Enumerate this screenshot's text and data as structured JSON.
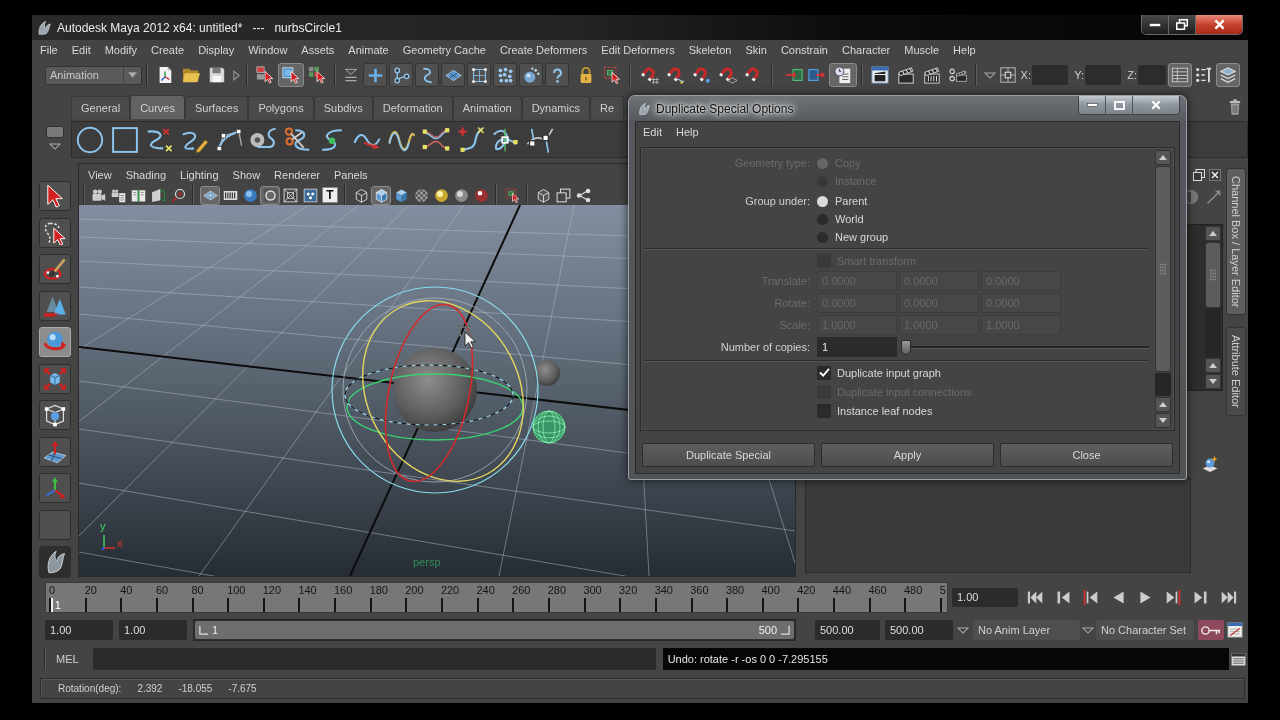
{
  "window": {
    "title": "Autodesk Maya 2012 x64: untitled*   ---   nurbsCircle1"
  },
  "menu_bar": [
    "File",
    "Edit",
    "Modify",
    "Create",
    "Display",
    "Window",
    "Assets",
    "Animate",
    "Geometry Cache",
    "Create Deformers",
    "Edit Deformers",
    "Skeleton",
    "Skin",
    "Constrain",
    "Character",
    "Muscle",
    "Help"
  ],
  "status_line": {
    "menu_set": "Animation",
    "selection_modes": [
      {
        "selected": false
      },
      {
        "selected": true
      },
      {
        "selected": false
      }
    ],
    "history": {
      "on": true
    },
    "coordinates": [
      {
        "label": "X:"
      },
      {
        "label": "Y:"
      },
      {
        "label": "Z:"
      }
    ],
    "panel_toggles": [
      {
        "on": true
      },
      {
        "on": false
      },
      {
        "on": true
      }
    ]
  },
  "shelf": {
    "tabs": [
      {
        "label": "General",
        "selected": false
      },
      {
        "label": "Curves",
        "selected": true
      },
      {
        "label": "Surfaces",
        "selected": false
      },
      {
        "label": "Polygons",
        "selected": false
      },
      {
        "label": "Subdivs",
        "selected": false
      },
      {
        "label": "Deformation",
        "selected": false
      },
      {
        "label": "Animation",
        "selected": false
      },
      {
        "label": "Dynamics",
        "selected": false
      },
      {
        "label": "Re",
        "selected": false
      }
    ]
  },
  "toolbox": {
    "tools": [
      {
        "selected": false
      },
      {
        "selected": false
      },
      {
        "selected": false
      },
      {
        "selected": false
      },
      {
        "selected": true
      },
      {
        "selected": false
      },
      {
        "selected": false
      },
      {
        "selected": false
      },
      {
        "selected": false
      }
    ]
  },
  "viewport": {
    "menu": [
      "View",
      "Shading",
      "Lighting",
      "Show",
      "Renderer",
      "Panels"
    ],
    "toolbar": [
      {
        "on": false
      },
      {
        "on": false
      },
      {
        "on": false
      },
      {
        "on": false
      },
      {
        "on": false
      },
      {
        "on": true
      },
      {
        "on": false
      },
      {
        "on": false
      },
      {
        "on": true
      },
      {
        "on": false
      },
      {
        "on": false
      },
      {
        "on": false,
        "label": "T"
      },
      {
        "on": false
      },
      {
        "on": true
      },
      {
        "on": false
      },
      {
        "on": false
      },
      {
        "on": false
      },
      {
        "on": false
      },
      {
        "on": false
      },
      {
        "on": false
      },
      {
        "on": false
      },
      {
        "on": false
      },
      {
        "on": false
      }
    ],
    "axis_labels": [
      "y",
      "x"
    ],
    "camera": "persp"
  },
  "side_panel": {
    "tabs": [
      {
        "label": "Channel Box / Layer Editor",
        "selected": true
      },
      {
        "label": "Attribute Editor",
        "selected": false
      }
    ]
  },
  "time_slider": {
    "ticks": [
      "0",
      "20",
      "40",
      "60",
      "80",
      "100",
      "120",
      "140",
      "160",
      "180",
      "200",
      "220",
      "240",
      "260",
      "280",
      "300",
      "320",
      "340",
      "360",
      "380",
      "400",
      "420",
      "440",
      "460",
      "480",
      "5"
    ],
    "current_frame": "1",
    "level": 0.002,
    "current_time": "1.00"
  },
  "range_slider": {
    "start_time": "1.00",
    "playback_start": "1.00",
    "range_start": "1",
    "range_end": "500",
    "level": 1,
    "playback_end": "500.00",
    "end_time": "500.00",
    "anim_layer": "No Anim Layer",
    "character_set": "No Character Set"
  },
  "command_line": {
    "language": "MEL",
    "result": "Undo: rotate -r -os 0 0 -7.295155"
  },
  "help_line": {
    "label": "Rotation(deg):",
    "values": [
      "2.392",
      "-18.055",
      "-7.675"
    ]
  },
  "dialog": {
    "title": "Duplicate Special Options",
    "menu": [
      "Edit",
      "Help"
    ],
    "sections": [
      {
        "rows": [
          {
            "kind": "radio",
            "label": "Geometry type:",
            "disabled": true,
            "options": [
              {
                "label": "Copy",
                "selected": true
              },
              {
                "label": "Instance",
                "selected": false
              }
            ]
          },
          {
            "kind": "radio",
            "label": "Group under:",
            "disabled": false,
            "options": [
              {
                "label": "Parent",
                "selected": true
              },
              {
                "label": "World",
                "selected": false
              },
              {
                "label": "New group",
                "selected": false
              }
            ]
          }
        ]
      },
      {
        "rows": [
          {
            "kind": "checkbox",
            "label": "Smart transform",
            "disabled": true,
            "checked": false
          },
          {
            "kind": "vector",
            "label": "Translate:",
            "disabled": true,
            "values": [
              "0.0000",
              "0.0000",
              "0.0000"
            ]
          },
          {
            "kind": "vector",
            "label": "Rotate:",
            "disabled": true,
            "values": [
              "0.0000",
              "0.0000",
              "0.0000"
            ]
          },
          {
            "kind": "vector",
            "label": "Scale:",
            "disabled": true,
            "values": [
              "1.0000",
              "1.0000",
              "1.0000"
            ]
          },
          {
            "kind": "slider",
            "label": "Number of copies:",
            "disabled": false,
            "value": "1",
            "level": 0
          }
        ]
      },
      {
        "rows": [
          {
            "kind": "checkbox",
            "label": "Duplicate input graph",
            "disabled": false,
            "checked": true
          },
          {
            "kind": "checkbox",
            "label": "Duplicate input connections",
            "disabled": true,
            "checked": false
          },
          {
            "kind": "checkbox",
            "label": "Instance leaf nodes",
            "disabled": false,
            "checked": false
          }
        ]
      }
    ],
    "buttons": [
      "Duplicate Special",
      "Apply",
      "Close"
    ]
  }
}
